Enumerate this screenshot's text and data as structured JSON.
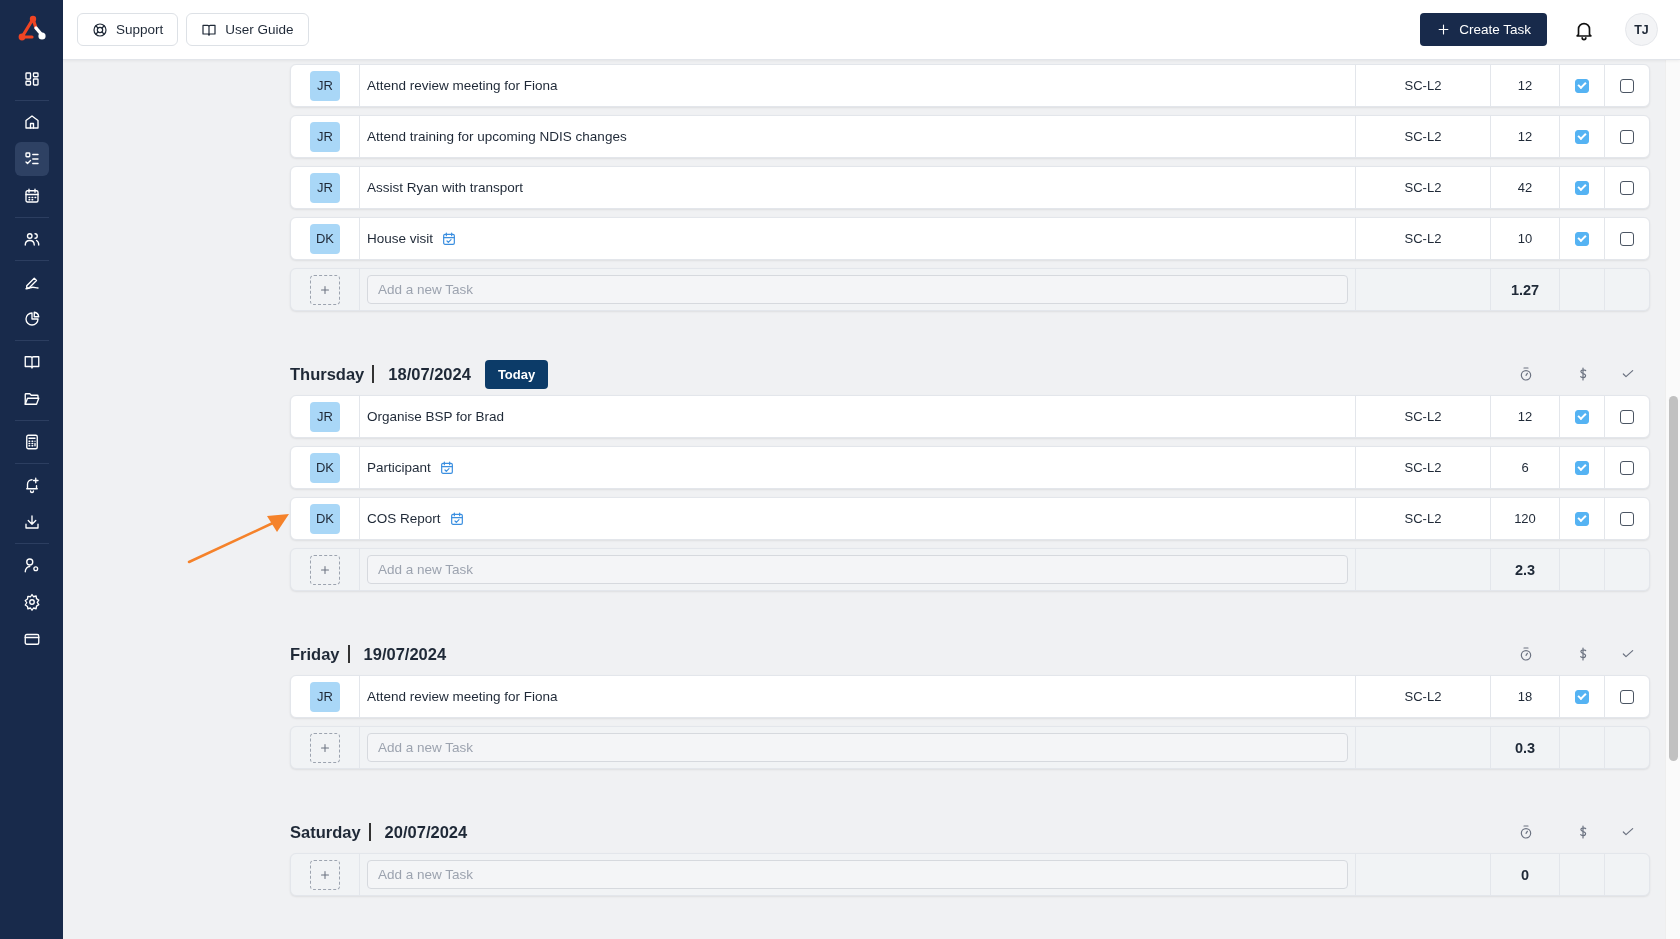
{
  "topbar": {
    "links": [
      {
        "kind": "support",
        "label": "Support"
      },
      {
        "kind": "guide",
        "label": "User Guide"
      }
    ],
    "create_button": "Create Task",
    "avatar": "TJ"
  },
  "sidebar": {
    "sections": [
      [
        {
          "kind": "dashboard",
          "selected": false
        }
      ],
      [
        {
          "kind": "home",
          "selected": false
        },
        {
          "kind": "tasks",
          "selected": true
        },
        {
          "kind": "calendar",
          "selected": false
        }
      ],
      [
        {
          "kind": "users",
          "selected": false
        }
      ],
      [
        {
          "kind": "pen",
          "selected": false
        },
        {
          "kind": "pie",
          "selected": false
        }
      ],
      [
        {
          "kind": "book",
          "selected": false
        },
        {
          "kind": "folder",
          "selected": false
        }
      ],
      [
        {
          "kind": "calculator",
          "selected": false
        }
      ],
      [
        {
          "kind": "bell",
          "selected": false
        },
        {
          "kind": "download",
          "selected": false
        }
      ],
      [
        {
          "kind": "usergear",
          "selected": false
        },
        {
          "kind": "settings",
          "selected": false
        },
        {
          "kind": "card",
          "selected": false
        }
      ]
    ]
  },
  "groups": [
    {
      "tasks": [
        {
          "initials": "JR",
          "title": "Attend review meeting for Fiona",
          "calendar": false,
          "code": "SC-L2",
          "minutes": "12",
          "billable": true,
          "done": false
        },
        {
          "initials": "JR",
          "title": "Attend training for upcoming NDIS changes",
          "calendar": false,
          "code": "SC-L2",
          "minutes": "12",
          "billable": true,
          "done": false
        },
        {
          "initials": "JR",
          "title": "Assist Ryan with transport",
          "calendar": false,
          "code": "SC-L2",
          "minutes": "42",
          "billable": true,
          "done": false
        },
        {
          "initials": "DK",
          "title": "House visit",
          "calendar": true,
          "code": "SC-L2",
          "minutes": "10",
          "billable": true,
          "done": false
        }
      ],
      "add_placeholder": "Add a new Task",
      "total": "1.27"
    },
    {
      "day": "Thursday",
      "date": "18/07/2024",
      "badge": "Today",
      "tasks": [
        {
          "initials": "JR",
          "title": "Organise BSP for Brad",
          "calendar": false,
          "code": "SC-L2",
          "minutes": "12",
          "billable": true,
          "done": false
        },
        {
          "initials": "DK",
          "title": "Participant",
          "calendar": true,
          "code": "SC-L2",
          "minutes": "6",
          "billable": true,
          "done": false
        },
        {
          "initials": "DK",
          "title": "COS Report",
          "calendar": true,
          "code": "SC-L2",
          "minutes": "120",
          "billable": true,
          "done": false
        }
      ],
      "add_placeholder": "Add a new Task",
      "total": "2.3"
    },
    {
      "day": "Friday",
      "date": "19/07/2024",
      "tasks": [
        {
          "initials": "JR",
          "title": "Attend review meeting for Fiona",
          "calendar": false,
          "code": "SC-L2",
          "minutes": "18",
          "billable": true,
          "done": false
        }
      ],
      "add_placeholder": "Add a new Task",
      "total": "0.3"
    },
    {
      "day": "Saturday",
      "date": "20/07/2024",
      "add_placeholder": "Add a new Task",
      "total": "0"
    }
  ]
}
